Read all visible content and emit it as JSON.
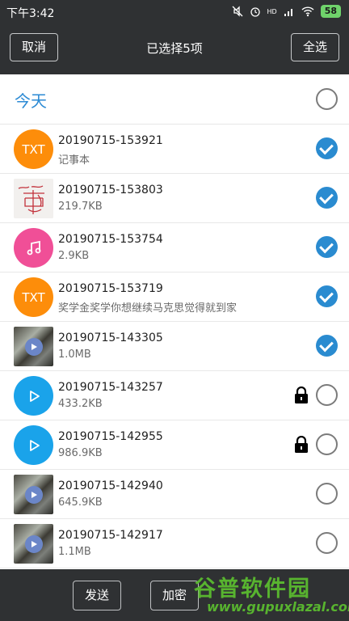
{
  "status_bar": {
    "time": "下午3:42",
    "signal_label": "HD",
    "battery": "58"
  },
  "header": {
    "cancel_label": "取消",
    "title": "已选择5项",
    "select_all_label": "全选"
  },
  "section": {
    "label": "今天",
    "checked": false
  },
  "files": [
    {
      "name": "20190715-153921",
      "sub": "记事本",
      "thumb": "txt",
      "thumb_text": "TXT",
      "checked": true,
      "locked": false
    },
    {
      "name": "20190715-153803",
      "sub": "219.7KB",
      "thumb": "handwriting-photo",
      "checked": true,
      "locked": false
    },
    {
      "name": "20190715-153754",
      "sub": "2.9KB",
      "thumb": "music",
      "checked": true,
      "locked": false
    },
    {
      "name": "20190715-153719",
      "sub": "奖学金奖学你想继续马克思觉得就到家",
      "thumb": "txt",
      "thumb_text": "TXT",
      "checked": true,
      "locked": false
    },
    {
      "name": "20190715-143305",
      "sub": "1.0MB",
      "thumb": "video",
      "checked": true,
      "locked": false
    },
    {
      "name": "20190715-143257",
      "sub": "433.2KB",
      "thumb": "play",
      "checked": false,
      "locked": true
    },
    {
      "name": "20190715-142955",
      "sub": "986.9KB",
      "thumb": "play",
      "checked": false,
      "locked": true
    },
    {
      "name": "20190715-142940",
      "sub": "645.9KB",
      "thumb": "video",
      "checked": false,
      "locked": false
    },
    {
      "name": "20190715-142917",
      "sub": "1.1MB",
      "thumb": "video",
      "checked": false,
      "locked": false
    }
  ],
  "bottom_bar": {
    "send_label": "发送",
    "encrypt_label": "加密"
  },
  "watermark": {
    "title": "谷普软件园",
    "url": "www.gupuxlazal.com"
  },
  "colors": {
    "accent": "#2a8bd0",
    "toolbar": "#2f3133",
    "txt_icon": "#fd8d0a",
    "music_icon": "#f04f97",
    "play_icon": "#1aa3ea",
    "watermark": "#58b42f"
  }
}
